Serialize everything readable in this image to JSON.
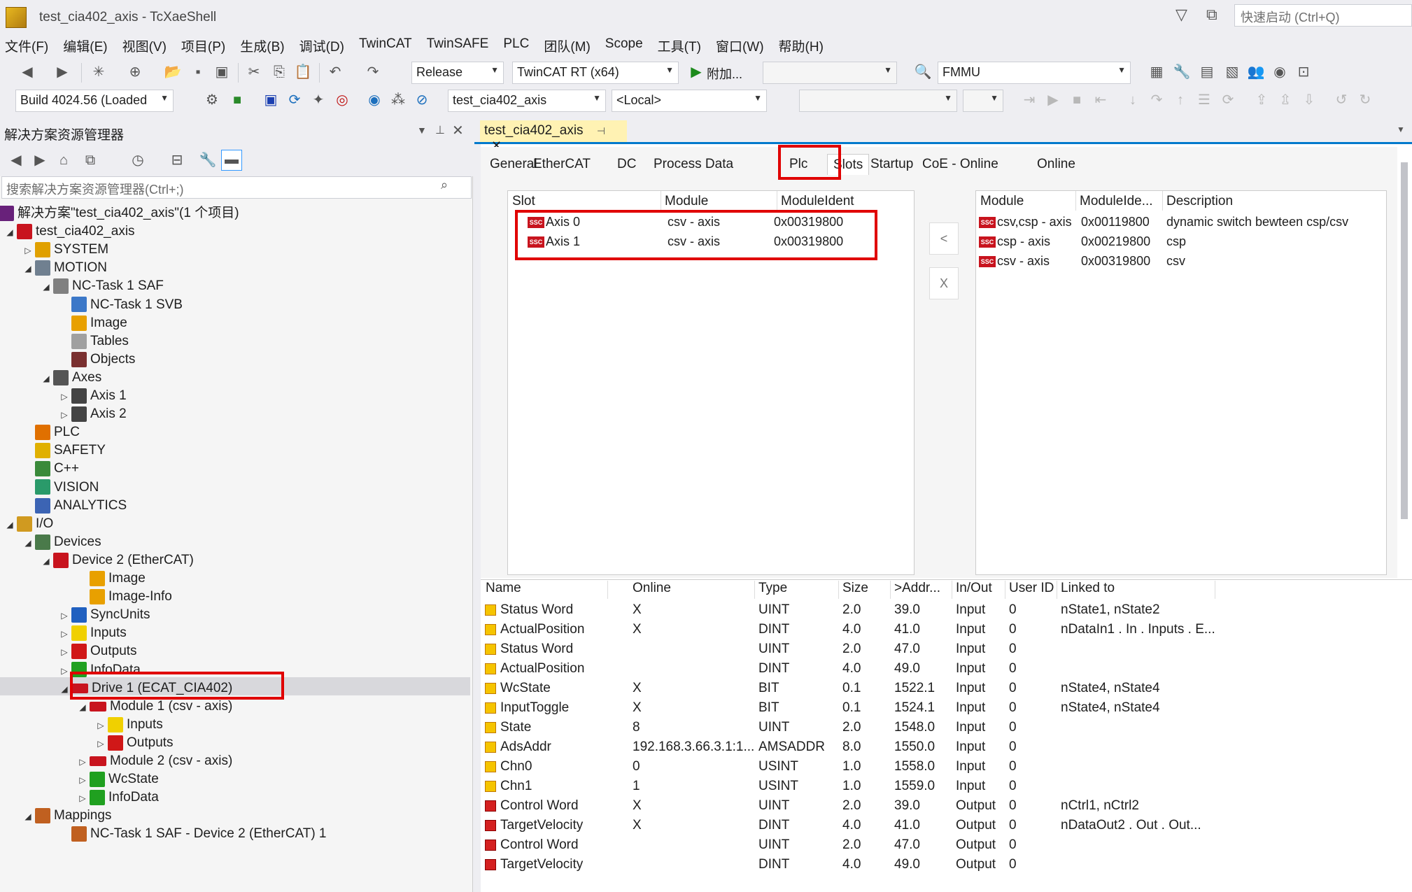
{
  "window": {
    "title": "test_cia402_axis - TcXaeShell",
    "quick_launch_placeholder": "快速启动 (Ctrl+Q)"
  },
  "menu": [
    "文件(F)",
    "编辑(E)",
    "视图(V)",
    "项目(P)",
    "生成(B)",
    "调试(D)",
    "TwinCAT",
    "TwinSAFE",
    "PLC",
    "团队(M)",
    "Scope",
    "工具(T)",
    "窗口(W)",
    "帮助(H)"
  ],
  "toolbar1": {
    "configuration": "Release",
    "platform": "TwinCAT RT (x64)",
    "attach_label": "附加...",
    "fmmu_value": "FMMU"
  },
  "toolbar2": {
    "build": "Build 4024.56 (Loaded",
    "project": "test_cia402_axis",
    "target": "<Local>"
  },
  "solution_explorer": {
    "title": "解决方案资源管理器",
    "search_placeholder": "搜索解决方案资源管理器(Ctrl+;)",
    "nodes": [
      "解决方案\"test_cia402_axis\"(1 个项目)",
      "test_cia402_axis",
      "SYSTEM",
      "MOTION",
      "NC-Task 1 SAF",
      "NC-Task 1 SVB",
      "Image",
      "Tables",
      "Objects",
      "Axes",
      "Axis 1",
      "Axis 2",
      "PLC",
      "SAFETY",
      "C++",
      "VISION",
      "ANALYTICS",
      "I/O",
      "Devices",
      "Device 2 (EtherCAT)",
      "Image",
      "Image-Info",
      "SyncUnits",
      "Inputs",
      "Outputs",
      "InfoData",
      "Drive 1 (ECAT_CIA402)",
      "Module 1 (csv -  axis)",
      "Inputs",
      "Outputs",
      "Module 2 (csv -  axis)",
      "WcState",
      "InfoData",
      "Mappings",
      "NC-Task 1 SAF - Device 2 (EtherCAT) 1"
    ]
  },
  "document": {
    "tab_title": "test_cia402_axis",
    "subtabs": [
      "General",
      "EtherCAT",
      "DC",
      "Process Data",
      "Plc",
      "Slots",
      "Startup",
      "CoE - Online",
      "Online"
    ],
    "active_subtab": "Slots",
    "slots_headers": [
      "Slot",
      "Module",
      "ModuleIdent"
    ],
    "slots_rows": [
      [
        "Axis 0",
        "csv -  axis",
        "0x00319800"
      ],
      [
        "Axis 1",
        "csv -  axis",
        "0x00319800"
      ]
    ],
    "modules_headers": [
      "Module",
      "ModuleIde...",
      "Description"
    ],
    "modules_rows": [
      [
        "csv,csp - axis",
        "0x00119800",
        "dynamic switch bewteen csp/csv"
      ],
      [
        "csp - axis",
        "0x00219800",
        "csp"
      ],
      [
        "csv -  axis",
        "0x00319800",
        "csv"
      ]
    ],
    "insert_button": "<",
    "remove_button": "X",
    "icon_text": "SSC"
  },
  "variables": {
    "headers": [
      "Name",
      "Online",
      "Type",
      "Size",
      ">Addr...",
      "In/Out",
      "User ID",
      "Linked to"
    ],
    "rows": [
      [
        "Status Word",
        "X",
        "UINT",
        "2.0",
        "39.0",
        "Input",
        "0",
        "nState1, nState2",
        "in"
      ],
      [
        "ActualPosition",
        "X",
        "DINT",
        "4.0",
        "41.0",
        "Input",
        "0",
        "nDataIn1 . In . Inputs . E...",
        "in"
      ],
      [
        "Status Word",
        "",
        "UINT",
        "2.0",
        "47.0",
        "Input",
        "0",
        "",
        "in"
      ],
      [
        "ActualPosition",
        "",
        "DINT",
        "4.0",
        "49.0",
        "Input",
        "0",
        "",
        "in"
      ],
      [
        "WcState",
        "X",
        "BIT",
        "0.1",
        "1522.1",
        "Input",
        "0",
        "nState4, nState4",
        "in"
      ],
      [
        "InputToggle",
        "X",
        "BIT",
        "0.1",
        "1524.1",
        "Input",
        "0",
        "nState4, nState4",
        "in"
      ],
      [
        "State",
        "8",
        "UINT",
        "2.0",
        "1548.0",
        "Input",
        "0",
        "",
        "in"
      ],
      [
        "AdsAddr",
        "192.168.3.66.3.1:1...",
        "AMSADDR",
        "8.0",
        "1550.0",
        "Input",
        "0",
        "",
        "in"
      ],
      [
        "Chn0",
        "0",
        "USINT",
        "1.0",
        "1558.0",
        "Input",
        "0",
        "",
        "in"
      ],
      [
        "Chn1",
        "1",
        "USINT",
        "1.0",
        "1559.0",
        "Input",
        "0",
        "",
        "in"
      ],
      [
        "Control Word",
        "X",
        "UINT",
        "2.0",
        "39.0",
        "Output",
        "0",
        "nCtrl1, nCtrl2",
        "out"
      ],
      [
        "TargetVelocity",
        "X",
        "DINT",
        "4.0",
        "41.0",
        "Output",
        "0",
        "nDataOut2 . Out . Out...",
        "out"
      ],
      [
        "Control Word",
        "",
        "UINT",
        "2.0",
        "47.0",
        "Output",
        "0",
        "",
        "out"
      ],
      [
        "TargetVelocity",
        "",
        "DINT",
        "4.0",
        "49.0",
        "Output",
        "0",
        "",
        "out"
      ]
    ]
  },
  "colors": {
    "accent": "#007acc",
    "highlight_box": "#e00000",
    "active_tab": "#fff2b3"
  }
}
